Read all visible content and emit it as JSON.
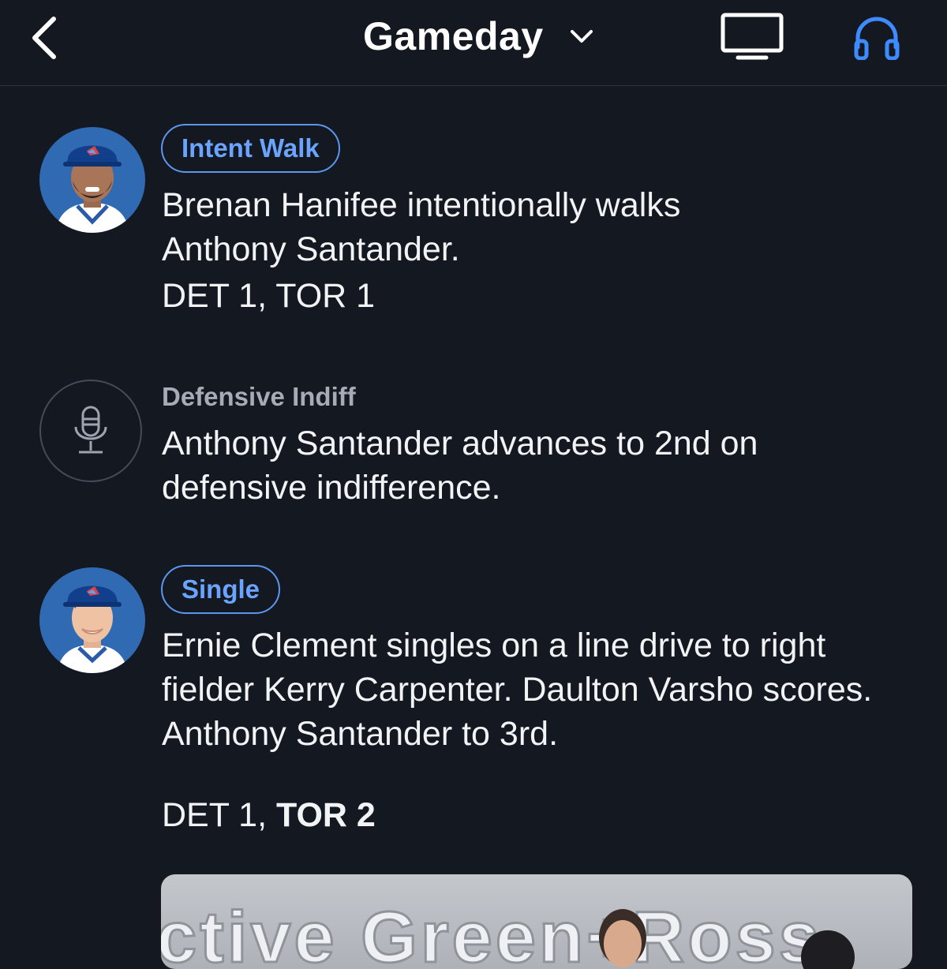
{
  "header": {
    "title": "Gameday",
    "back_icon": "chevron-left-icon",
    "title_icon": "chevron-down-icon",
    "tv_icon": "tv-icon",
    "audio_icon": "headphones-icon",
    "audio_color": "#3d8bff"
  },
  "events": [
    {
      "type": "player",
      "badge": "Intent Walk",
      "description": "Brenan Hanifee intentionally walks Anthony Santander.",
      "score": {
        "away": "DET 1",
        "home": "TOR 1",
        "home_bold": false
      }
    },
    {
      "type": "mic",
      "label": "Defensive Indiff",
      "description": "Anthony Santander advances to 2nd on defensive indifference."
    },
    {
      "type": "player",
      "badge": "Single",
      "description": "Ernie Clement singles on a line drive to right fielder Kerry Carpenter. Daulton Varsho scores. Anthony Santander to 3rd.",
      "score": {
        "away": "DET 1",
        "home": "TOR 2",
        "home_bold": true
      }
    }
  ],
  "video": {
    "overlay_text": "ctive Green+Ross"
  },
  "colors": {
    "background": "#141821",
    "badge_blue": "#5b97f0",
    "text": "#f2f3f5",
    "muted": "#a6abb6"
  }
}
